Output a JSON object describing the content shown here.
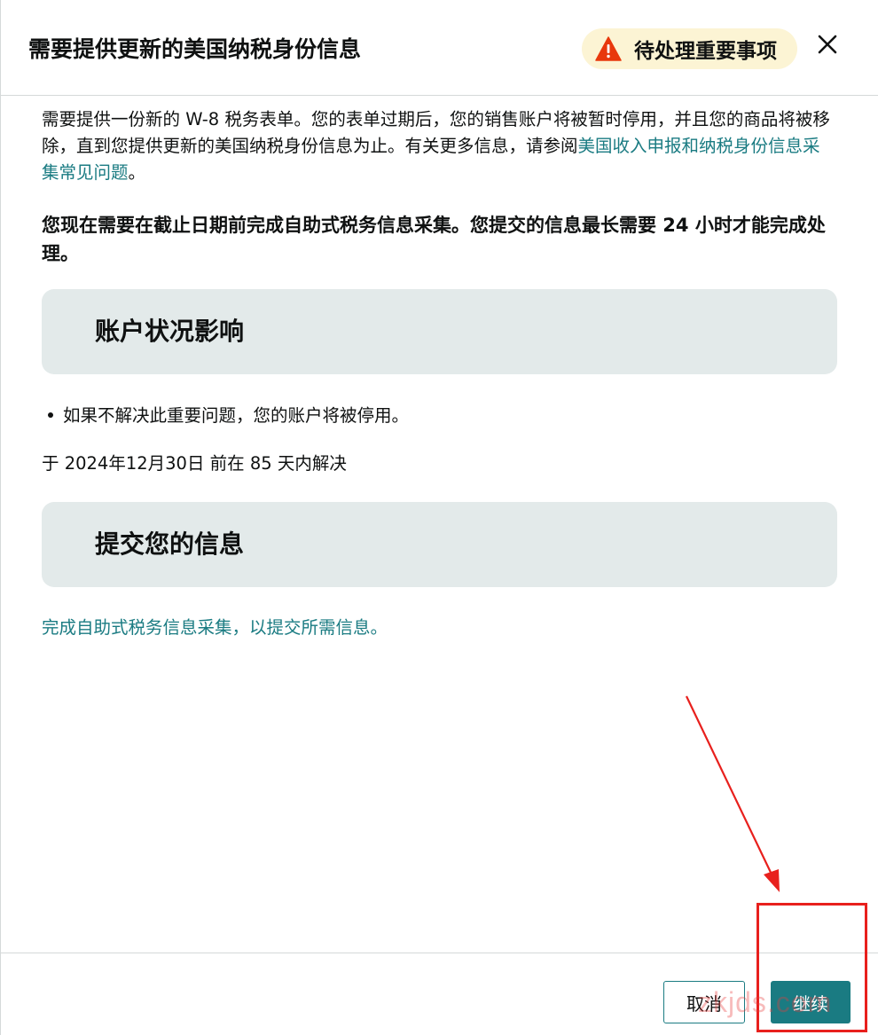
{
  "modal": {
    "title": "需要提供更新的美国纳税身份信息",
    "badge_label": "待处理重要事项",
    "intro_text_before_link": "需要提供一份新的 W-8 税务表单。您的表单过期后，您的销售账户将被暂时停用，并且您的商品将被移除，直到您提供更新的美国纳税身份信息为止。有关更多信息，请参阅",
    "intro_link": "美国收入申报和纳税身份信息采集常见问题",
    "intro_text_after_link": "。",
    "notice_bold": "您现在需要在截止日期前完成自助式税务信息采集。您提交的信息最长需要 24 小时才能完成处理。"
  },
  "sections": {
    "impact": {
      "heading": "账户状况影响",
      "bullet": "如果不解决此重要问题，您的账户将被停用。",
      "deadline": "于 2024年12月30日 前在 85 天内解决"
    },
    "submit": {
      "heading": "提交您的信息",
      "action_link": "完成自助式税务信息采集，以提交所需信息。"
    }
  },
  "footer": {
    "cancel_label": "取消",
    "continue_label": "继续"
  },
  "watermark": "zkjds.com",
  "colors": {
    "link": "#1a7b82",
    "primary_button": "#1a7b82",
    "badge_bg": "#fcf4d4",
    "warning_icon": "#e8380d",
    "section_bg": "#e3eaea",
    "annotation": "#e8201d"
  },
  "icons": {
    "badge": "warning-triangle-icon",
    "close": "close-icon"
  }
}
